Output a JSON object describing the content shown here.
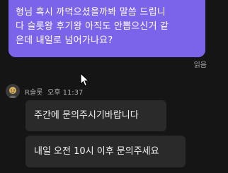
{
  "messages": {
    "sent": {
      "text": "형님 혹시 까먹으셨을까봐 말씀 드립니\n다 슬롯왕 후기왕 아직도 안뽑으신거 같\n은데 내일로 넘어가나요?",
      "status": "읽음"
    },
    "received": {
      "sender": "R슬롯",
      "time": "오후 11:37",
      "items": [
        {
          "text": "주간에 문의주시기바랍니다"
        },
        {
          "text": "내일 오전 10시 이후 문의주세요"
        }
      ]
    }
  },
  "colors": {
    "background": "#151515",
    "sent_bubble": "#7b64e9",
    "received_bubble": "#2a2a2a",
    "meta_text": "#a3a3a3"
  },
  "icons": {
    "cursor": "mouse-pointer-icon",
    "avatar": "avatar-icon"
  }
}
